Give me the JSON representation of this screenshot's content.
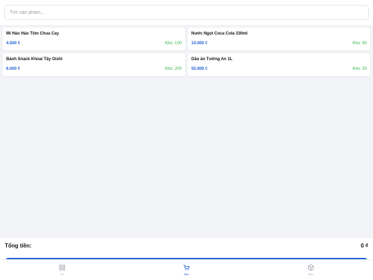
{
  "search": {
    "placeholder": "Tìm sản phẩm..."
  },
  "products": [
    {
      "name": "Mì Hảo Hảo Tôm Chua Cay",
      "price": "4.500 ₫",
      "stock": "Kho: 100"
    },
    {
      "name": "Nước Ngọt Coca Cola 330ml",
      "price": "10.000 ₫",
      "stock": "Kho: 50"
    },
    {
      "name": "Bánh Snack Khoai Tây Oishi",
      "price": "6.000 ₫",
      "stock": "Kho: 200"
    },
    {
      "name": "Dầu ăn Tường An 1L",
      "price": "55.000 ₫",
      "stock": "Kho: 20"
    }
  ],
  "total": {
    "label": "Tổng tiền:",
    "value": "0 ₫"
  },
  "nav": {
    "items": [
      {
        "label": "TK",
        "icon": "grid-icon",
        "active": false
      },
      {
        "label": "Bán",
        "icon": "cart-icon",
        "active": true
      },
      {
        "label": "Kho",
        "icon": "box-icon",
        "active": false
      }
    ]
  },
  "colors": {
    "accent": "#1f5fd6",
    "stock": "#32b44a",
    "background": "#f1f3f6",
    "inactive": "#9aa0a8"
  }
}
